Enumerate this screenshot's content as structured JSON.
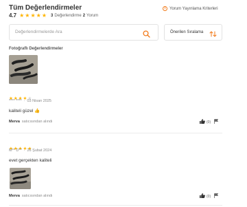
{
  "header": {
    "title": "Tüm Değerlendirmeler",
    "average": "4.7",
    "rating_count": "3",
    "rating_label": "Değerlendirme",
    "comment_count": "2",
    "comment_label": "Yorum",
    "criteria_link": "Yorum Yayınlama Kriterleri"
  },
  "search": {
    "placeholder": "Değerlendirmelerde Ara"
  },
  "sort": {
    "label": "Önerilen Sıralama"
  },
  "photo_section": {
    "label": "Fotoğraflı Değerlendirmeler"
  },
  "reviews": [
    {
      "rating": 4,
      "user": "**** ****",
      "date": "03 Nisan 2025",
      "comment": "kaliteli güzel 👍",
      "author": "Merva",
      "seller_text": "satıcısından alındı",
      "likes": "(0)"
    },
    {
      "rating": 5,
      "user": "M** D**",
      "date": "26 Şubat 2024",
      "comment": "evet gerçekten kaliteli",
      "author": "Merva",
      "seller_text": "satıcısından alındı",
      "likes": "(0)"
    }
  ],
  "colors": {
    "star": "#ffb400",
    "accent": "#f27a1a",
    "star_off": "#d6d6d6"
  },
  "icons": {
    "info": "info-icon",
    "search": "search-icon",
    "sort": "sort-arrows-icon",
    "like": "thumbs-up-icon",
    "report": "flag-icon"
  }
}
